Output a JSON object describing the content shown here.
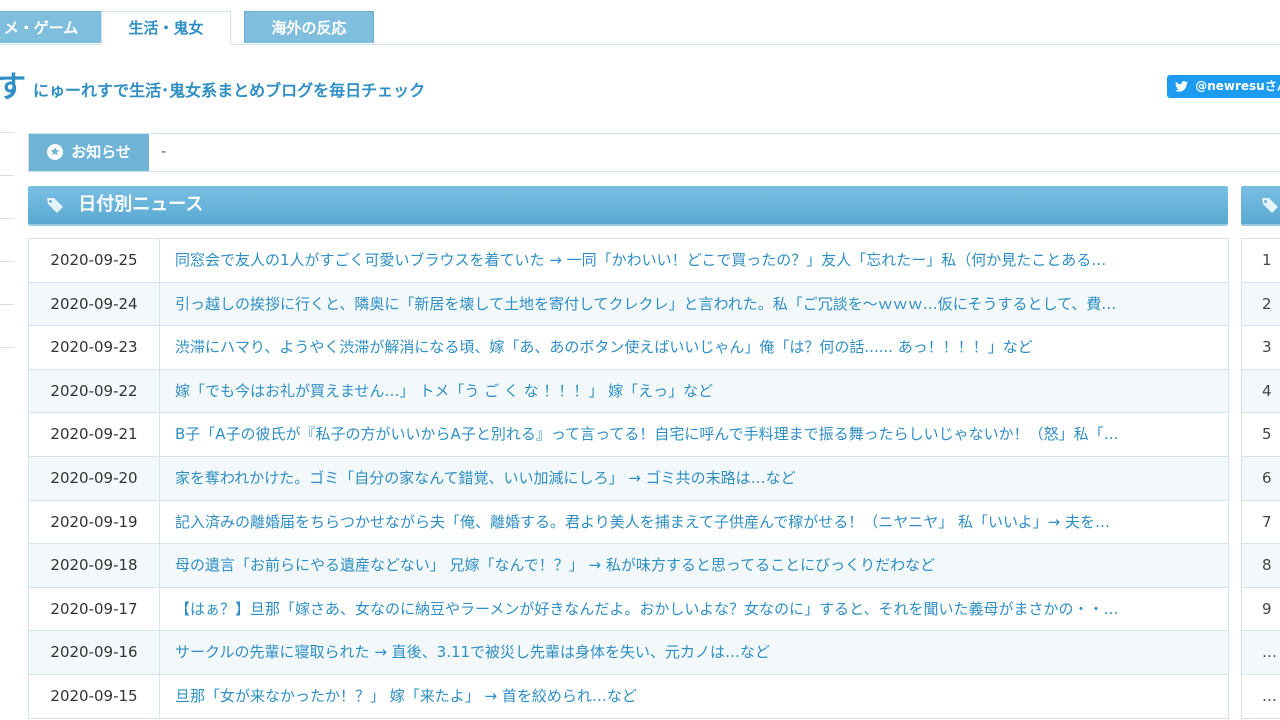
{
  "tabs": [
    {
      "label": "メ・ゲーム",
      "active": false
    },
    {
      "label": "生活・鬼女",
      "active": true
    },
    {
      "label": "海外の反応",
      "active": false
    }
  ],
  "site": {
    "title_fragment": "す",
    "tagline": "にゅーれすで生活･鬼女系まとめブログを毎日チェック",
    "twitter_handle": "@newresuさん"
  },
  "notice": {
    "label": "お知らせ",
    "text": "-"
  },
  "sections": {
    "main_title": "日付別ニュース"
  },
  "news": [
    {
      "date": "2020-09-25",
      "title": "同窓会で友人の1人がすごく可愛いブラウスを着ていた → 一同「かわいい！どこで買ったの？」友人「忘れたー」私（何か見たことある…"
    },
    {
      "date": "2020-09-24",
      "title": "引っ越しの挨拶に行くと、隣奥に「新居を壊して土地を寄付してクレクレ」と言われた。私「ご冗談を〜ｗｗｗ…仮にそうするとして、費…"
    },
    {
      "date": "2020-09-23",
      "title": "渋滞にハマり、ようやく渋滞が解消になる頃、嫁「あ、あのボタン使えばいいじゃん」俺「は？何の話...... あっ！！！！」など"
    },
    {
      "date": "2020-09-22",
      "title": "嫁「でも今はお礼が買えません…」 トメ「う ご く な ！！！」 嫁「えっ」など"
    },
    {
      "date": "2020-09-21",
      "title": "B子「A子の彼氏が『私子の方がいいからA子と別れる』って言ってる！自宅に呼んで手料理まで振る舞ったらしいじゃないか！（怒」私「…"
    },
    {
      "date": "2020-09-20",
      "title": "家を奪われかけた。ゴミ「自分の家なんて錯覚、いい加減にしろ」 → ゴミ共の末路は…など"
    },
    {
      "date": "2020-09-19",
      "title": "記入済みの離婚届をちらつかせながら夫「俺、離婚する。君より美人を捕まえて子供産んで稼がせる！（ニヤニヤ」 私「いいよ」→ 夫を…"
    },
    {
      "date": "2020-09-18",
      "title": "母の遺言「お前らにやる遺産などない」 兄嫁「なんで！？」 → 私が味方すると思ってることにびっくりだわなど"
    },
    {
      "date": "2020-09-17",
      "title": "【はぁ？】旦那「嫁さあ、女なのに納豆やラーメンが好きなんだよ。おかしいよな？女なのに」すると、それを聞いた義母がまさかの・・…"
    },
    {
      "date": "2020-09-16",
      "title": "サークルの先輩に寝取られた → 直後、3.11で被災し先輩は身体を失い、元カノは…など"
    },
    {
      "date": "2020-09-15",
      "title": "旦那「女が来なかったか！？」 嫁「来たよ」 → 首を絞められ…など"
    }
  ],
  "ranks": [
    "1",
    "2",
    "3",
    "4",
    "5",
    "6",
    "7",
    "8",
    "9",
    "…",
    "…"
  ],
  "colors": {
    "accent": "#2f8fc4",
    "header_bg": "#6fb3d6",
    "twitter": "#1d9bf0"
  }
}
